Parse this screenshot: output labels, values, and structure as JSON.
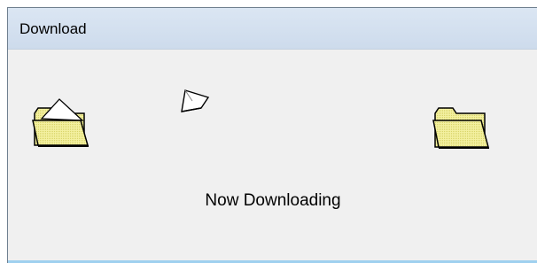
{
  "window": {
    "title": "Download"
  },
  "status": {
    "text": "Now Downloading"
  },
  "icons": {
    "source": "open-folder-icon",
    "flying": "flying-document-icon",
    "destination": "folder-icon"
  },
  "colors": {
    "folder_fill": "#f2ef9a",
    "folder_stroke": "#000000",
    "titlebar": "#d5e1f0",
    "client_area": "#f0f0f0"
  }
}
